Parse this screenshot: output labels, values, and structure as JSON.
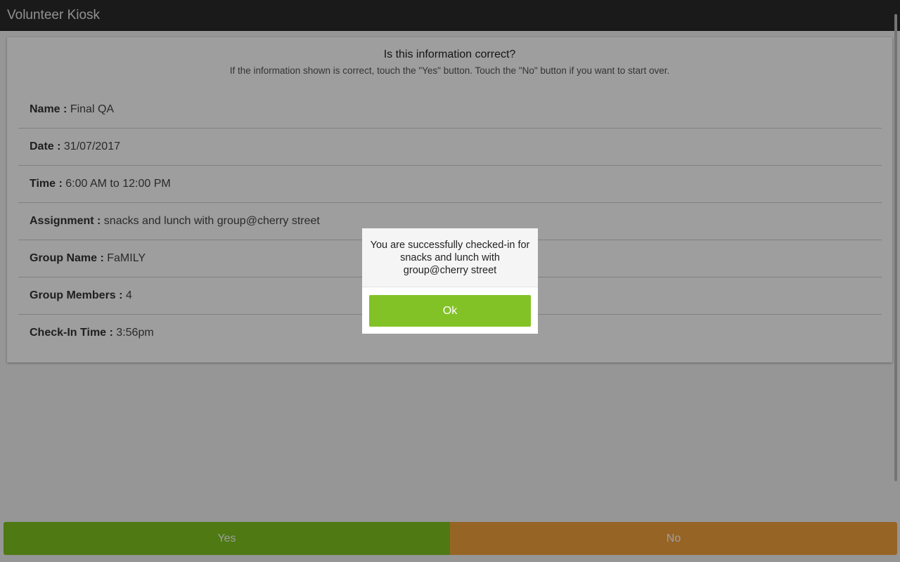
{
  "app": {
    "title": "Volunteer Kiosk"
  },
  "confirm": {
    "heading": "Is this information correct?",
    "instructions": "If the information shown is correct, touch the \"Yes\" button. Touch the \"No\" button if you want to start over.",
    "rows": [
      {
        "label": "Name :",
        "value": "Final QA"
      },
      {
        "label": "Date :",
        "value": "31/07/2017"
      },
      {
        "label": "Time :",
        "value": "6:00 AM to 12:00 PM"
      },
      {
        "label": "Assignment :",
        "value": "snacks and lunch with group@cherry street"
      },
      {
        "label": "Group Name :",
        "value": "FaMILY"
      },
      {
        "label": "Group Members :",
        "value": "4"
      },
      {
        "label": "Check-In Time :",
        "value": "3:56pm"
      }
    ]
  },
  "actions": {
    "yes_label": "Yes",
    "no_label": "No"
  },
  "dialog": {
    "message": "You are successfully checked-in for snacks and lunch with group@cherry street",
    "ok_label": "Ok"
  },
  "colors": {
    "titlebar": "#2b2b2b",
    "yes": "#7ec41f",
    "no": "#f2a43e",
    "ok": "#82c226"
  }
}
